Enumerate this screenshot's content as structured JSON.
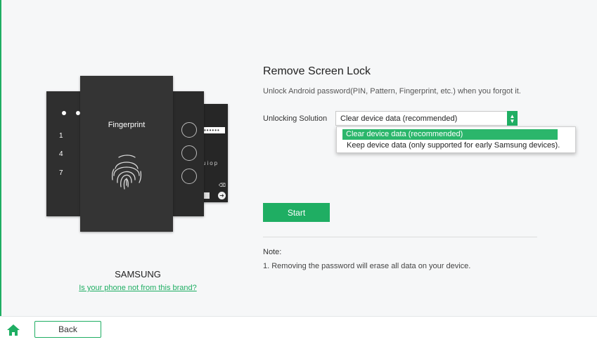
{
  "illustration": {
    "fingerprint_label": "Fingerprint",
    "pin_digits": [
      "1",
      "4",
      "7"
    ],
    "keyboard_text": "uiop",
    "password_dots": "••••••"
  },
  "brand": {
    "name": "SAMSUNG",
    "link": "Is your phone not from this brand?"
  },
  "main": {
    "title": "Remove Screen Lock",
    "subtitle": "Unlock Android password(PIN, Pattern, Fingerprint, etc.) when you forgot it.",
    "solution_label": "Unlocking Solution",
    "solution_selected": "Clear device data (recommended)",
    "solution_options": [
      "Clear device data (recommended)",
      "Keep device data (only supported for early Samsung devices)."
    ],
    "start_label": "Start",
    "note_title": "Note:",
    "note_text": "1. Removing the password will erase all data on your device."
  },
  "footer": {
    "back_label": "Back"
  },
  "colors": {
    "accent": "#1fae63",
    "background": "#f6f7f8",
    "phone": "#343434"
  },
  "icons": {
    "home": "home-icon",
    "select_arrow": "chevron-updown-icon",
    "fingerprint": "fingerprint-icon"
  }
}
